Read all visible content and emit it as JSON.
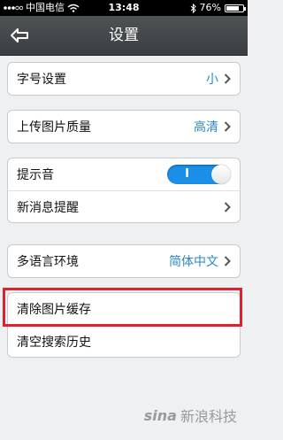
{
  "status_bar": {
    "carrier": "中国电信",
    "time": "13:48",
    "battery": "76%",
    "battery_level": 0.76
  },
  "nav": {
    "title": "设置"
  },
  "settings": {
    "font_size": {
      "label": "字号设置",
      "value": "小"
    },
    "upload_quality": {
      "label": "上传图片质量",
      "value": "高清"
    },
    "sound": {
      "label": "提示音",
      "toggle_text": "I",
      "enabled": true
    },
    "new_message": {
      "label": "新消息提醒"
    },
    "language": {
      "label": "多语言环境",
      "value": "简体中文"
    },
    "clear_image_cache": {
      "label": "清除图片缓存"
    },
    "clear_search_history": {
      "label": "清空搜索历史"
    }
  },
  "watermark": {
    "logo": "sina",
    "text": "新浪科技"
  },
  "colors": {
    "accent": "#2c86c9",
    "toggle": "#1b8fe8",
    "highlight": "#e0202a"
  }
}
